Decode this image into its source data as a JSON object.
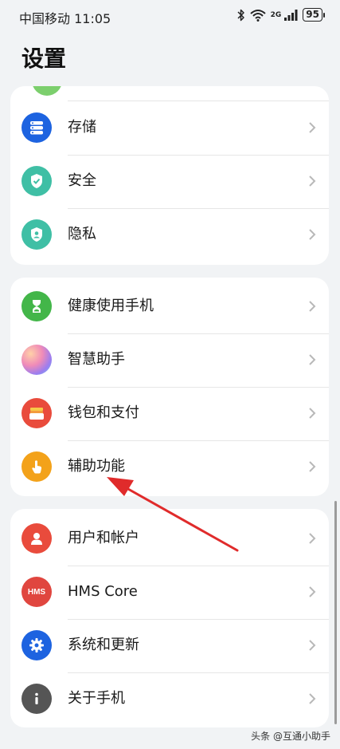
{
  "status_bar": {
    "carrier": "中国移动",
    "time": "11:05",
    "network_type": "2G",
    "battery": "95"
  },
  "page": {
    "title": "设置"
  },
  "groups": [
    {
      "items": [
        {
          "label": "存储",
          "icon": "storage-icon",
          "color": "#1d63e0"
        },
        {
          "label": "安全",
          "icon": "shield-check-icon",
          "color": "#3fbfa5"
        },
        {
          "label": "隐私",
          "icon": "privacy-icon",
          "color": "#3fbfa5"
        }
      ]
    },
    {
      "items": [
        {
          "label": "健康使用手机",
          "icon": "hourglass-icon",
          "color": "#43b649"
        },
        {
          "label": "智慧助手",
          "icon": "celia-orb-icon",
          "color": "#c876e0"
        },
        {
          "label": "钱包和支付",
          "icon": "wallet-icon",
          "color": "#e94b3c"
        },
        {
          "label": "辅助功能",
          "icon": "hand-tap-icon",
          "color": "#f3a21a"
        }
      ]
    },
    {
      "items": [
        {
          "label": "用户和帐户",
          "icon": "user-icon",
          "color": "#e94b3c"
        },
        {
          "label": "HMS Core",
          "icon": "hms-core-icon",
          "color": "#e0463f",
          "icon_text": "HMS"
        },
        {
          "label": "系统和更新",
          "icon": "gear-icon",
          "color": "#1d63e0"
        },
        {
          "label": "关于手机",
          "icon": "info-icon",
          "color": "#555555"
        }
      ]
    }
  ],
  "watermark": "头条 @互通小助手"
}
